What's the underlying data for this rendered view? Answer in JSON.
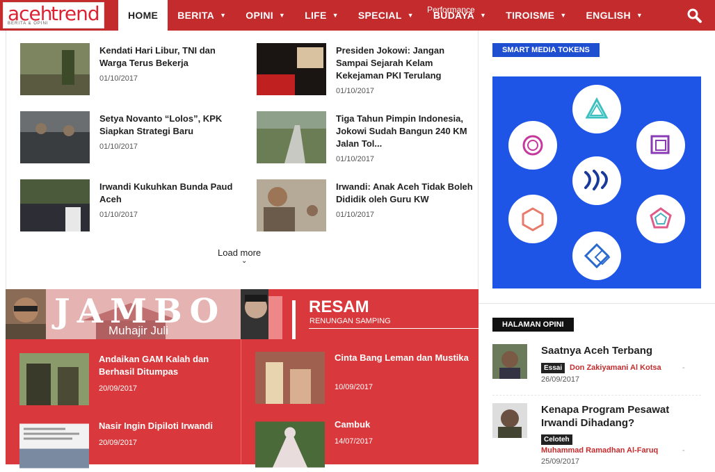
{
  "brand": {
    "name_a": "aceh",
    "name_b": "trend",
    "tagline": "BERITA & OPINI",
    "accent": "#c42b2d"
  },
  "nav": {
    "items": [
      {
        "label": "HOME"
      },
      {
        "label": "BERITA"
      },
      {
        "label": "OPINI"
      },
      {
        "label": "LIFE"
      },
      {
        "label": "SPECIAL"
      },
      {
        "label": "BUDAYA"
      },
      {
        "label": "TIROISME"
      },
      {
        "label": "ENGLISH"
      }
    ],
    "overlay_label": "Performance"
  },
  "main": {
    "articles": [
      {
        "title": "Kendati Hari Libur, TNI dan Warga Terus Bekerja",
        "date": "01/10/2017"
      },
      {
        "title": "Presiden Jokowi: Jangan Sampai Sejarah Kelam Kekejaman PKI Terulang",
        "date": "01/10/2017"
      },
      {
        "title": "Setya Novanto “Lolos”, KPK Siapkan Strategi Baru",
        "date": "01/10/2017"
      },
      {
        "title": "Tiga Tahun Pimpin Indonesia, Jokowi Sudah Bangun 240 KM Jalan Tol...",
        "date": "01/10/2017"
      },
      {
        "title": "Irwandi Kukuhkan Bunda Paud Aceh",
        "date": "01/10/2017"
      },
      {
        "title": "Irwandi: Anak Aceh Tidak Boleh Dididik oleh Guru KW",
        "date": "01/10/2017"
      }
    ],
    "load_more": "Load more"
  },
  "jambo": {
    "banner_title": "JAMBO",
    "banner_author": "Muhajir Juli",
    "articles": [
      {
        "title": "Andaikan GAM Kalah dan Berhasil Ditumpas",
        "date": "20/09/2017"
      },
      {
        "title": "Nasir Ingin Dipiloti Irwandi",
        "date": "20/09/2017"
      }
    ]
  },
  "resam": {
    "banner_title": "RESAM",
    "banner_subtitle": "RENUNGAN SAMPING",
    "articles": [
      {
        "title": "Cinta Bang Leman dan Mustika",
        "date": "10/09/2017"
      },
      {
        "title": "Cambuk",
        "date": "14/07/2017"
      }
    ]
  },
  "sidebar": {
    "smt_tag": "SMART MEDIA TOKENS",
    "opini_tag": "HALAMAN OPINI",
    "opini": [
      {
        "title": "Saatnya Aceh Terbang",
        "badge": "Essai",
        "author": "Don Zakiyamani Al Kotsa",
        "date": "26/09/2017"
      },
      {
        "title": "Kenapa Program Pesawat Irwandi Dihadang?",
        "badge": "Celoteh",
        "author": "Muhammad Ramadhan Al-Faruq",
        "date": "25/09/2017"
      }
    ]
  }
}
